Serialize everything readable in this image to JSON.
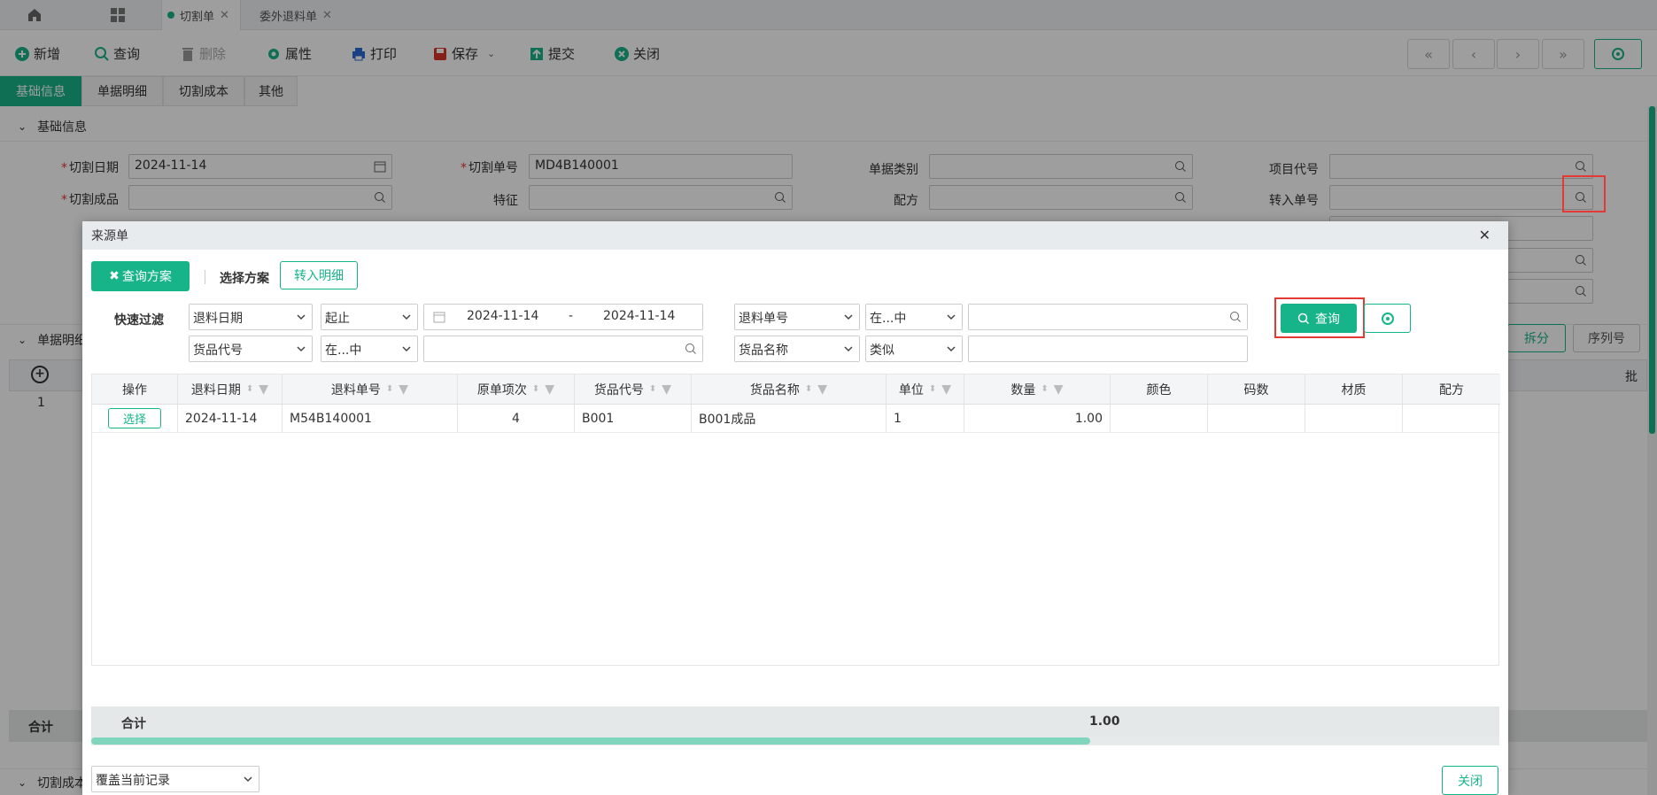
{
  "tabs": [
    {
      "label": ""
    },
    {
      "label": ""
    },
    {
      "label": "切割单"
    },
    {
      "label": "委外退料单"
    }
  ],
  "toolbar": {
    "new": "新增",
    "query": "查询",
    "delete": "删除",
    "props": "属性",
    "print": "打印",
    "save": "保存",
    "submit": "提交",
    "close": "关闭"
  },
  "nav": {
    "first": "«",
    "prev": "‹",
    "next": "›",
    "last": "»"
  },
  "section_tabs": [
    "基础信息",
    "单据明细",
    "切割成本",
    "其他"
  ],
  "section_title": "基础信息",
  "form": {
    "cut_date_label": "切割日期",
    "cut_date": "2024-11-14",
    "cut_no_label": "切割单号",
    "cut_no": "MD4B140001",
    "doc_type_label": "单据类别",
    "project_label": "项目代号",
    "product_label": "切割成品",
    "feature_label": "特征",
    "recipe_label": "配方",
    "transfer_label": "转入单号"
  },
  "bg_detail": {
    "title": "单据明细",
    "split": "拆分",
    "serial": "序列号",
    "batch": "批",
    "row1": "1",
    "total": "合计",
    "cost": "切割成本"
  },
  "modal": {
    "title": "来源单",
    "scheme_btn": "查询方案",
    "choose_scheme": "选择方案",
    "transfer_detail": "转入明细",
    "quick_filter": "快速过滤",
    "f1_field": "退料日期",
    "f1_op": "起止",
    "f1_from": "2024-11-14",
    "f1_dash": "-",
    "f1_to": "2024-11-14",
    "f2_field": "退料单号",
    "f2_op": "在...中",
    "f3_field": "货品代号",
    "f3_op": "在...中",
    "f4_field": "货品名称",
    "f4_op": "类似",
    "query_btn": "查询",
    "columns": [
      "操作",
      "退料日期",
      "退料单号",
      "原单项次",
      "货品代号",
      "货品名称",
      "单位",
      "数量",
      "颜色",
      "码数",
      "材质",
      "配方"
    ],
    "rows": [
      {
        "action": "选择",
        "date": "2024-11-14",
        "no": "M54B140001",
        "item": "4",
        "code": "B001",
        "name": "B001成品",
        "unit": "1",
        "qty": "1.00"
      }
    ],
    "total_label": "合计",
    "total_qty": "1.00",
    "mode": "覆盖当前记录",
    "close": "关闭"
  }
}
